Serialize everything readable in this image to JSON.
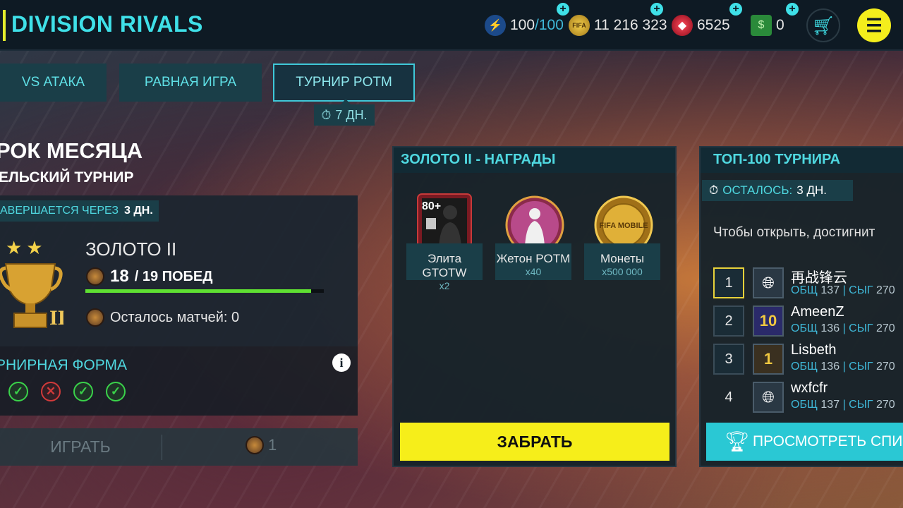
{
  "header": {
    "title": "DIVISION RIVALS",
    "energy": "100",
    "energy_max": "/100",
    "coins": "11 216 323",
    "gems": "6525",
    "cash": "0",
    "coins_icon_text": "FIFA",
    "colors": {
      "accent": "#3fe0e8",
      "highlight": "#f4ee1c"
    }
  },
  "tabs": [
    {
      "label": "VS АТАКА"
    },
    {
      "label": "РАВНАЯ ИГРА"
    },
    {
      "label": "ТУРНИР POTM"
    }
  ],
  "tab_timer": "7 ДН.",
  "event": {
    "title": "РОК МЕСЯЦА",
    "subtitle": "ЕЛЬСКИЙ ТУРНИР",
    "ends_label": "АВЕРШАЕТСЯ ЧЕРЕЗ",
    "ends_value": "3 ДН.",
    "tier_name": "ЗОЛОТО II",
    "tier_numeral": "II",
    "wins_current": "18",
    "wins_total": "/ 19 ПОБЕД",
    "wins_progress": 0.947,
    "matches_left": "Осталось матчей: 0",
    "form_label": "РНИРНАЯ ФОРМА",
    "form": [
      "win",
      "loss",
      "win",
      "win"
    ],
    "play_label": "ИГРАТЬ",
    "play_cost": "1"
  },
  "rewards": {
    "title": "ЗОЛОТО II - НАГРАДЫ",
    "items": [
      {
        "name": "Элита GTOTW",
        "qty": "x2",
        "badge": "80+"
      },
      {
        "name": "Жетон POTM",
        "qty": "x40"
      },
      {
        "name": "Монеты",
        "qty": "x500 000",
        "coin_text": "FIFA MOBILE"
      }
    ],
    "claim_label": "ЗАБРАТЬ"
  },
  "top100": {
    "title": "ТОП-100 ТУРНИРА",
    "remain_label": "ОСТАЛОСЬ:",
    "remain_value": "3 ДН.",
    "hint": "Чтобы открыть, достигнит",
    "ovr_label": "ОБЩ",
    "sig_label": "| СЫГ",
    "players": [
      {
        "rank": "1",
        "name": "再战锋云",
        "ovr": "137",
        "sig": "270"
      },
      {
        "rank": "2",
        "name": "AmeenZ",
        "ovr": "136",
        "sig": "270",
        "avatar_text": "10"
      },
      {
        "rank": "3",
        "name": "Lisbeth",
        "ovr": "136",
        "sig": "270",
        "avatar_text": "1"
      },
      {
        "rank": "4",
        "name": "wxfcfr",
        "ovr": "137",
        "sig": "270"
      }
    ],
    "view_label": "ПРОСМОТРЕТЬ СПИ"
  }
}
